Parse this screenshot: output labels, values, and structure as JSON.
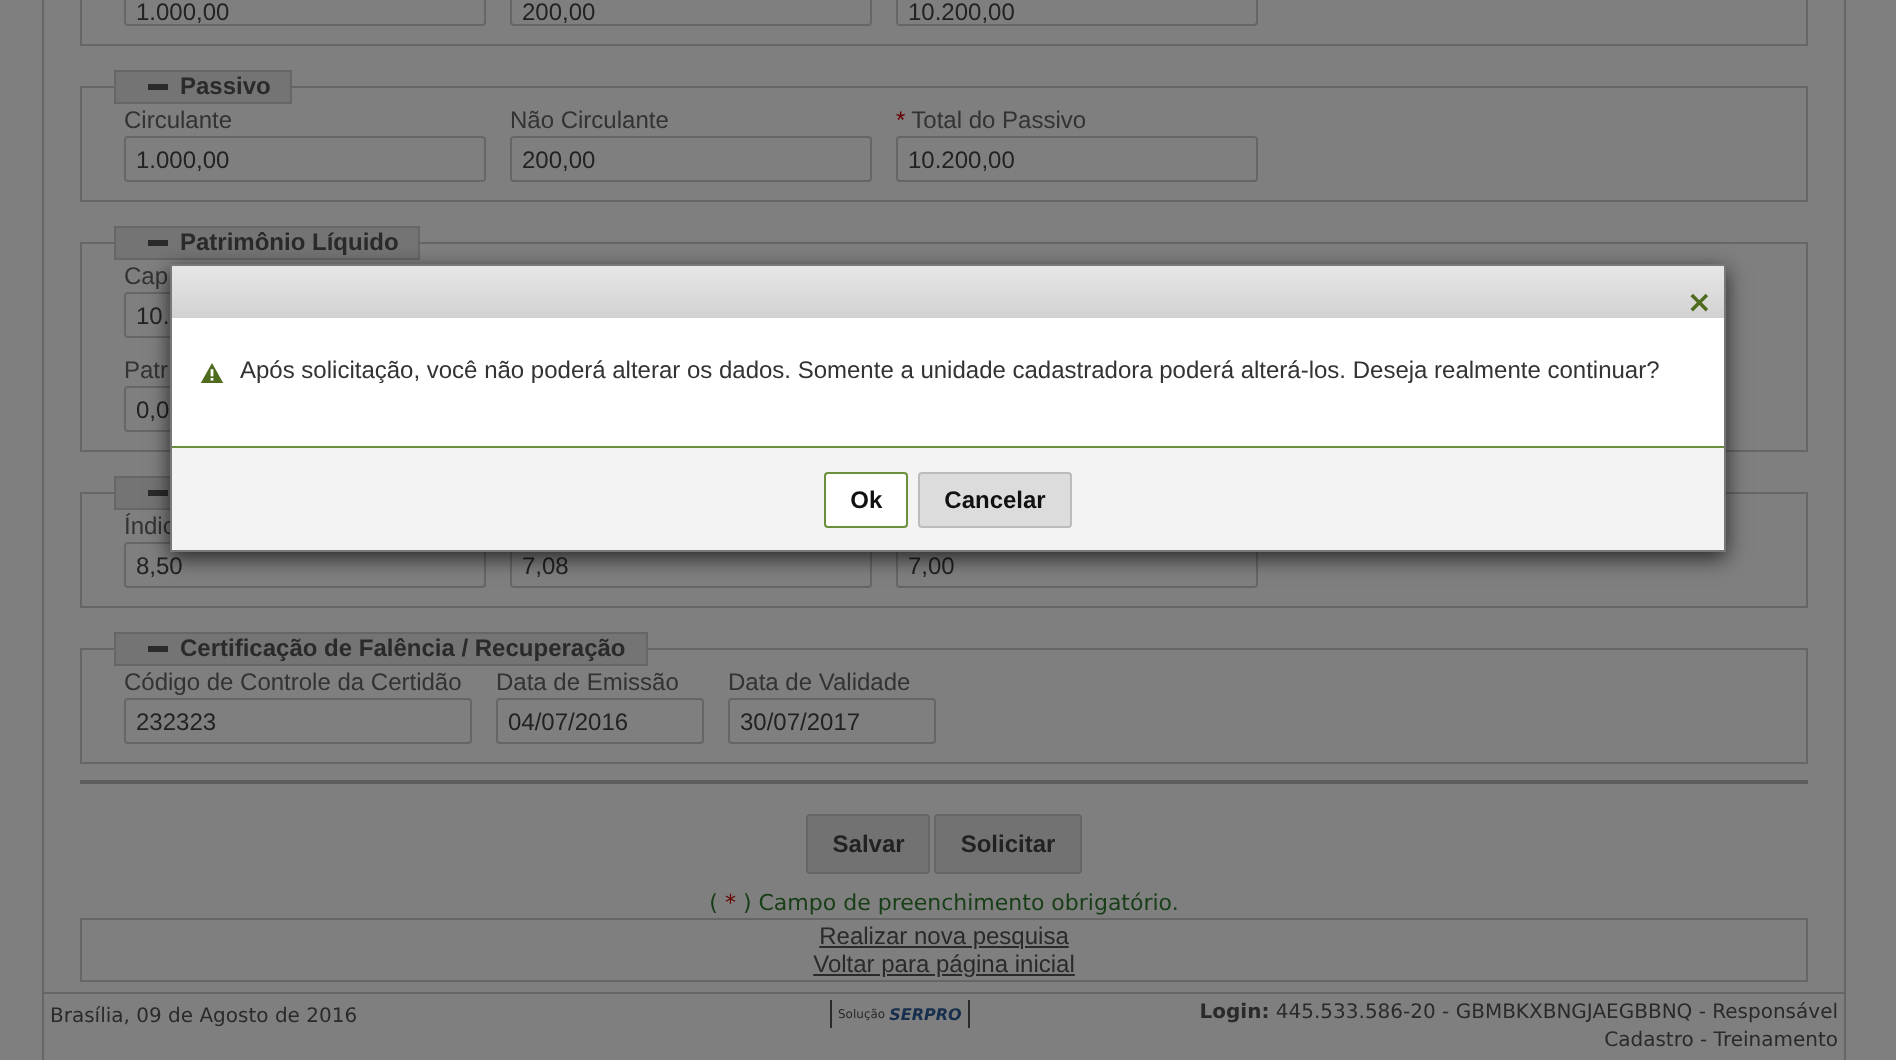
{
  "sections": [
    {
      "rows": [
        [
          {
            "value": "1.000,00"
          },
          {
            "value": "200,00"
          },
          {
            "value": "10.200,00"
          }
        ]
      ]
    },
    {
      "legend": {
        "text": "Passivo",
        "expanded": true
      },
      "rows": [
        [
          {
            "label": "Circulante",
            "value": "1.000,00"
          },
          {
            "label": "Não Circulante",
            "value": "200,00"
          },
          {
            "label": "Total do Passivo",
            "required_mark": "*",
            "value": "10.200,00"
          }
        ]
      ]
    },
    {
      "legend": {
        "text": "Patrimônio Líquido",
        "expanded": true
      },
      "rows": [
        [
          {
            "label": "Cap",
            "value": "10."
          }
        ],
        [
          {
            "label": "Patr",
            "value": "0,0"
          }
        ]
      ]
    },
    {
      "legend": {
        "expanded": true
      },
      "rows": [
        [
          {
            "label": "Índic",
            "value": "8,50"
          },
          {
            "value": "7,08"
          },
          {
            "value": "7,00"
          }
        ]
      ]
    },
    {
      "legend": {
        "text": "Certificação de Falência / Recuperação",
        "expanded": true
      },
      "rows": [
        [
          {
            "label": "Código de Controle da Certidão",
            "value": "232323"
          },
          {
            "label": "Data de Emissão",
            "value": "04/07/2016"
          },
          {
            "label": "Data de Validade",
            "value": "30/07/2017"
          }
        ]
      ]
    }
  ],
  "actions": [
    "Salvar",
    "Solicitar"
  ],
  "required_note": {
    "open": "(",
    "mark": "*",
    "text": ") Campo de preenchimento obrigatório."
  },
  "links": [
    "Realizar nova pesquisa",
    "Voltar para página inicial"
  ],
  "footer": {
    "date": "Brasília, 09 de Agosto de 2016",
    "logo_caption": "Solução",
    "logo_name": "SERPRO",
    "login": "**Login:** 445.533.586-20 - GBMBKXBNGJAEGBBNQ - Responsável Cadastro - Treinamento"
  },
  "dialog": {
    "message": "Após solicitação, você não poderá alterar os dados. Somente a unidade cadastradora poderá alterá-los. Deseja realmente continuar?",
    "close": "×",
    "buttons": [
      {
        "label": "Ok",
        "selected": true
      },
      {
        "label": "Cancelar",
        "selected": false
      }
    ]
  }
}
